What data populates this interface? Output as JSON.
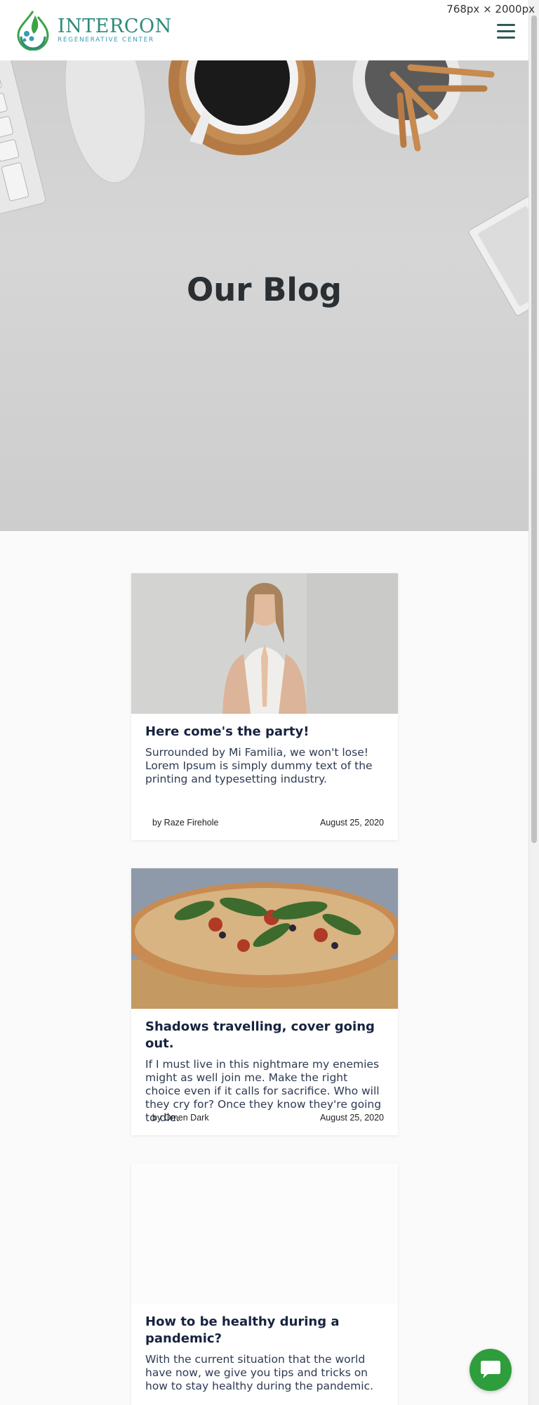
{
  "viewport_label": "768px × 2000px",
  "brand": {
    "name": "INTERCON",
    "tagline": "REGENERATIVE CENTER",
    "primary_color": "#2d8a7a",
    "accent_color": "#3a9bb3"
  },
  "header": {
    "menu_icon": "hamburger-menu-icon"
  },
  "hero": {
    "title": "Our Blog"
  },
  "posts": [
    {
      "title": "Here come's the party!",
      "excerpt": "Surrounded by Mi Familia, we won't lose! Lorem Ipsum is simply dummy text of the printing and typesetting industry.",
      "author": "by Raze Firehole",
      "date": "August 25, 2020",
      "image": "woman-meditating-photo"
    },
    {
      "title": "Shadows travelling, cover going out.",
      "excerpt": "If I must live in this nightmare my enemies might as well join me. Make the right choice even if it calls for sacrifice. Who will they cry for? Once they know they're going to die.",
      "author": "by Omen Dark",
      "date": "August 25, 2020",
      "image": "pizza-photo"
    },
    {
      "title": "How to be healthy during a pandemic?",
      "excerpt": "With the current situation that the world have now, we give you tips and tricks on how to stay healthy during the pandemic.",
      "image": "blank-image"
    }
  ],
  "chat": {
    "icon": "chat-bubble-icon",
    "color": "#2e9e3c"
  }
}
